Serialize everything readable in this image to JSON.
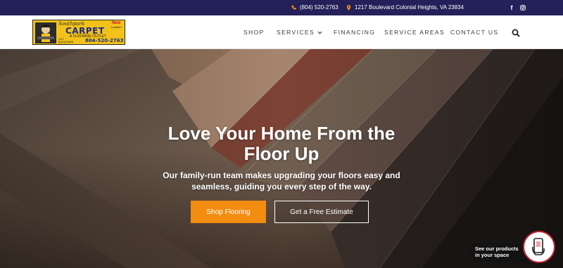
{
  "topbar": {
    "phone": "(804) 520-2763",
    "address": "1217 Boulevard Colonial Heights, VA 23834",
    "social": [
      {
        "icon": "facebook-icon",
        "glyph": "f"
      },
      {
        "icon": "instagram-icon"
      }
    ]
  },
  "logo": {
    "script": "Southpark",
    "main": "CARPET",
    "sub": "& FLOORING OUTLET",
    "address_small": "1217 BOULEVARD COLONIAL HEIGHTS",
    "phone": "804-520-2763",
    "badge_line1": "New",
    "badge_line2": "Location"
  },
  "nav": {
    "items": [
      "SHOP",
      "SERVICES",
      "FINANCING",
      "SERVICE AREAS",
      "CONTACT US"
    ]
  },
  "hero": {
    "title_line1": "Love Your Home From the",
    "title_line2": "Floor Up",
    "subtitle_line1": "Our family-run team makes upgrading your floors easy and",
    "subtitle_line2": "seamless, guiding you every step of the way.",
    "primary_cta": "Shop Flooring",
    "secondary_cta": "Get a Free Estimate"
  },
  "ar_widget": {
    "line1": "See our products",
    "line2": "in your space"
  },
  "colors": {
    "topbar_bg": "#24205a",
    "accent_orange": "#f28d12",
    "ar_border": "#c2202e"
  }
}
